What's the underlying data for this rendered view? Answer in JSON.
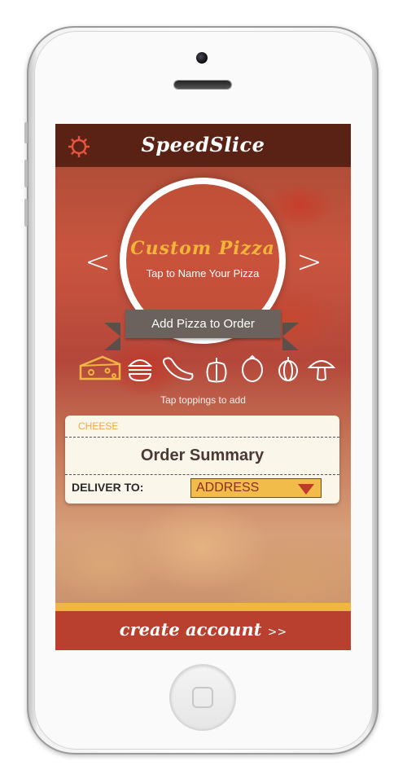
{
  "app": {
    "title": "SpeedSlice"
  },
  "pizza": {
    "name": "Custom Pizza",
    "name_hint": "Tap to Name Your Pizza",
    "prev_arrow": "<",
    "next_arrow": ">"
  },
  "actions": {
    "add_to_order": "Add Pizza to Order"
  },
  "toppings": {
    "icons": [
      "cheese-icon",
      "burger-icon",
      "sausage-icon",
      "pepper-icon",
      "tomato-icon",
      "onion-icon",
      "mushroom-icon"
    ],
    "hint": "Tap toppings to add"
  },
  "summary": {
    "selected_topping": "CHEESE",
    "title": "Order Summary",
    "deliver_label": "DELIVER TO:",
    "address_value": "ADDRESS"
  },
  "footer": {
    "create_account": "create account",
    "chevrons": ">>"
  },
  "colors": {
    "topbar": "#4e1c10",
    "accent_yellow": "#f0b544",
    "bottom_red": "#b9402f",
    "pizza_name": "#f3b43a",
    "ribbon": "#6b625d"
  }
}
